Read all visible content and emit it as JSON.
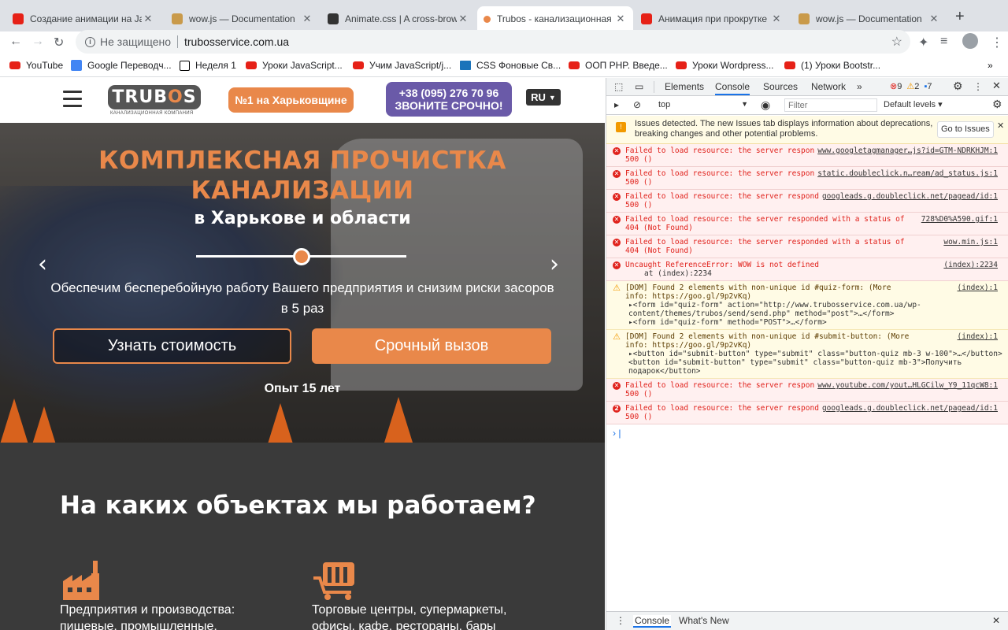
{
  "browser": {
    "tabs": [
      {
        "title": "Создание анимации на Jav",
        "icon": "youtube-icon",
        "color": "#e62117"
      },
      {
        "title": "wow.js — Documentation",
        "icon": "wow-icon",
        "color": "#c99a4a"
      },
      {
        "title": "Animate.css | A cross-brow",
        "icon": "animate-icon",
        "color": "#333333"
      },
      {
        "title": "Trubos - канализационная",
        "icon": "trubos-icon",
        "color": "#e9884a"
      },
      {
        "title": "Анимация при прокрутке (",
        "icon": "youtube-icon",
        "color": "#e62117"
      },
      {
        "title": "wow.js — Documentation",
        "icon": "wow-icon",
        "color": "#c99a4a"
      }
    ],
    "address": {
      "security": "Не защищено",
      "url": "trubosservice.com.ua"
    },
    "bookmarks": [
      {
        "label": "YouTube",
        "icon": "yt"
      },
      {
        "label": "Google Переводч...",
        "icon": "g"
      },
      {
        "label": "Неделя 1",
        "icon": "n"
      },
      {
        "label": "Уроки JavaScript...",
        "icon": "yt"
      },
      {
        "label": "Учим JavaScript/j...",
        "icon": "yt"
      },
      {
        "label": "CSS Фоновые Св...",
        "icon": "c"
      },
      {
        "label": "ООП PHP. Введе...",
        "icon": "yt"
      },
      {
        "label": "Уроки Wordpress...",
        "icon": "yt"
      },
      {
        "label": "(1) Уроки Bootstr...",
        "icon": "yt"
      }
    ],
    "bookmarks_more": "»"
  },
  "site": {
    "logo": {
      "text_a": "TRUB",
      "text_o": "O",
      "text_b": "S",
      "subtitle": "КАНАЛИЗАЦИОННАЯ КОМПАНИЯ"
    },
    "badge": "№1 на Харьковщине",
    "phone": {
      "number": "+38 (095) 276 70 96",
      "cta": "ЗВОНИТЕ СРОЧНО!"
    },
    "lang": "RU",
    "hero": {
      "title_line1": "КОМПЛЕКСНАЯ ПРОЧИСТКА",
      "title_line2": "КАНАЛИЗАЦИИ",
      "subtitle": "в Харькове и области",
      "description": "Обеспечим бесперебойную работу Вашего предприятия и снизим риски засоров в 5 раз",
      "btn_price": "Узнать стоимость",
      "btn_urgent": "Срочный вызов",
      "experience": "Опыт 15 лет"
    },
    "objects": {
      "heading": "На каких объектах мы работаем?",
      "cat1": "Предприятия и производства: пищевые, промышленные,",
      "cat2": "Торговые центры, супермаркеты, офисы, кафе, рестораны, бары"
    }
  },
  "devtools": {
    "tabs": [
      "Elements",
      "Console",
      "Sources",
      "Network"
    ],
    "active_tab": "Console",
    "counts": {
      "errors": "9",
      "warnings": "2",
      "info": "7"
    },
    "context": "top",
    "filter_placeholder": "Filter",
    "levels": "Default levels ▾",
    "issue_text": "Issues detected. The new Issues tab displays information about deprecations, breaking changes and other potential problems.",
    "issue_button": "Go to Issues",
    "logs": [
      {
        "type": "error",
        "msg": "Failed to load resource: the server responded with a status of 500 ()",
        "src": "www.googletagmanager…js?id=GTM-NDRKHJM:1"
      },
      {
        "type": "error",
        "msg": "Failed to load resource: the server responded with a status of 500 ()",
        "src": "static.doubleclick.n…ream/ad_status.js:1"
      },
      {
        "type": "error",
        "msg": "Failed to load resource: the server responded with a status of 500 ()",
        "src": "googleads.g.doubleclick.net/pagead/id:1"
      },
      {
        "type": "error",
        "msg": "Failed to load resource: the server responded with a status of 404 (Not Found)",
        "src": "728%D0%A590.gif:1"
      },
      {
        "type": "error",
        "msg": "Failed to load resource: the server responded with a status of 404 (Not Found)",
        "src": "wow.min.js:1"
      },
      {
        "type": "error",
        "msg": "Uncaught ReferenceError: WOW is not defined",
        "sub": "at (index):2234",
        "src": "(index):2234"
      },
      {
        "type": "warn",
        "msg": "[DOM] Found 2 elements with non-unique id #quiz-form: (More info: https://goo.gl/9p2vKq)",
        "src": "(index):1",
        "sub1": "▸<form id=\"quiz-form\" action=\"http://www.trubosservice.com.ua/wp-content/themes/trubos/send/send.php\" method=\"post\">…</form>",
        "sub2": "▸<form id=\"quiz-form\" method=\"POST\">…</form>"
      },
      {
        "type": "warn",
        "msg": "[DOM] Found 2 elements with non-unique id #submit-button: (More info: https://goo.gl/9p2vKq)",
        "src": "(index):1",
        "sub1": "▸<button id=\"submit-button\" type=\"submit\" class=\"button-quiz mb-3 w-100\">…</button>",
        "sub2": "<button id=\"submit-button\" type=\"submit\" class=\"button-quiz mb-3\">Получить подарок</button>"
      },
      {
        "type": "error",
        "msg": "Failed to load resource: the server responded with a status of 500 ()",
        "src": "www.youtube.com/yout…HLGCilw_Y9_11qcW8:1"
      },
      {
        "type": "error2",
        "msg": "Failed to load resource: the server responded with a status of 500 ()",
        "src": "googleads.g.doubleclick.net/pagead/id:1",
        "badge": "2"
      }
    ],
    "drawer_tabs": [
      "Console",
      "What's New"
    ]
  }
}
